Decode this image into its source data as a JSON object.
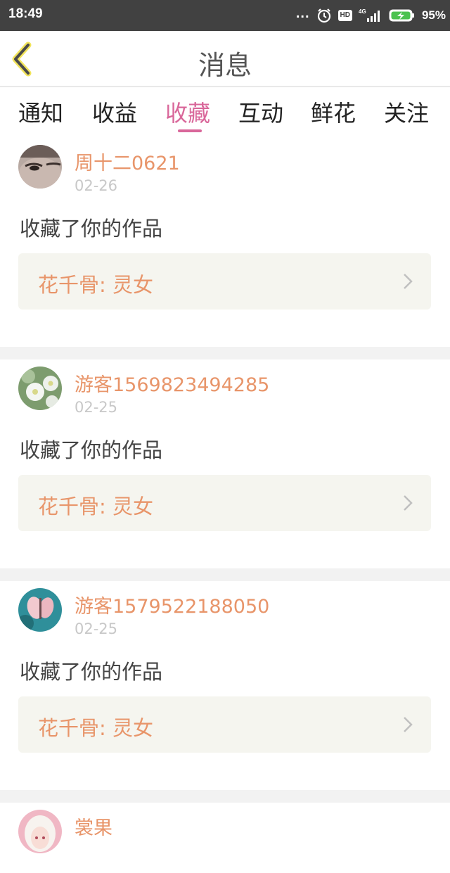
{
  "status_bar": {
    "time": "18:49",
    "dots": "...",
    "hd": "HD",
    "network": "4G",
    "battery": "95%"
  },
  "header": {
    "title": "消息",
    "back_icon": "chevron-left-icon"
  },
  "tabs": [
    {
      "label": "通知",
      "active": false
    },
    {
      "label": "收益",
      "active": false
    },
    {
      "label": "收藏",
      "active": true
    },
    {
      "label": "互动",
      "active": false
    },
    {
      "label": "鲜花",
      "active": false
    },
    {
      "label": "关注",
      "active": false
    }
  ],
  "messages": [
    {
      "user": "周十二0621",
      "date": "02-26",
      "action": "收藏了你的作品",
      "work": "花千骨: 灵女",
      "avatar": "face-avatar"
    },
    {
      "user": "游客1569823494285",
      "date": "02-25",
      "action": "收藏了你的作品",
      "work": "花千骨: 灵女",
      "avatar": "flower-avatar"
    },
    {
      "user": "游客1579522188050",
      "date": "02-25",
      "action": "收藏了你的作品",
      "work": "花千骨: 灵女",
      "avatar": "butterfly-avatar"
    },
    {
      "user": "裳果",
      "avatar": "anime-avatar"
    }
  ],
  "colors": {
    "accent_pink": "#d9679a",
    "name_orange": "#e8956a",
    "status_bar_bg": "#414141",
    "work_box_bg": "#f5f5ef",
    "separator": "#f2f2f2"
  }
}
